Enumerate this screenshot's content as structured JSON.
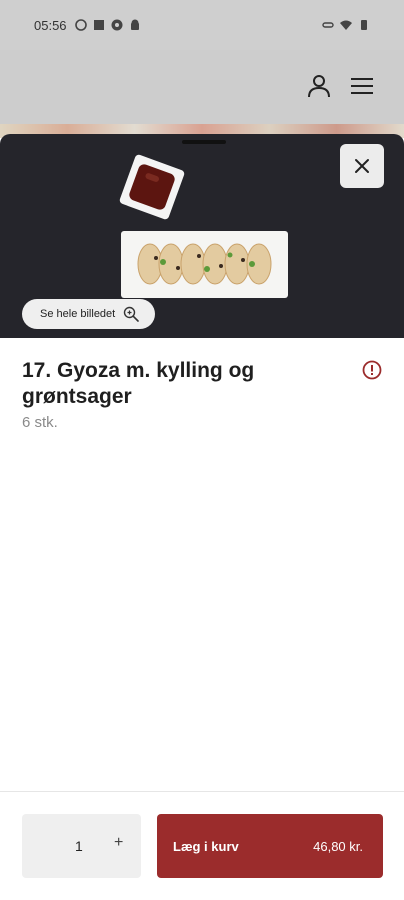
{
  "status_bar": {
    "time": "05:56"
  },
  "item": {
    "title": "17. Gyoza m. kylling og grøntsager",
    "subtitle": "6 stk."
  },
  "image_button": {
    "label": "Se hele billedet"
  },
  "quantity": {
    "value": "1",
    "plus": "+"
  },
  "cart_button": {
    "label": "Læg i kurv",
    "price": "46,80 kr."
  },
  "colors": {
    "accent": "#9b2c2c",
    "hero_bg": "#25252b",
    "overlay": "#cdcdcd"
  },
  "icons": [
    "user-icon",
    "menu-icon",
    "close-icon",
    "zoom-icon",
    "info-icon"
  ]
}
